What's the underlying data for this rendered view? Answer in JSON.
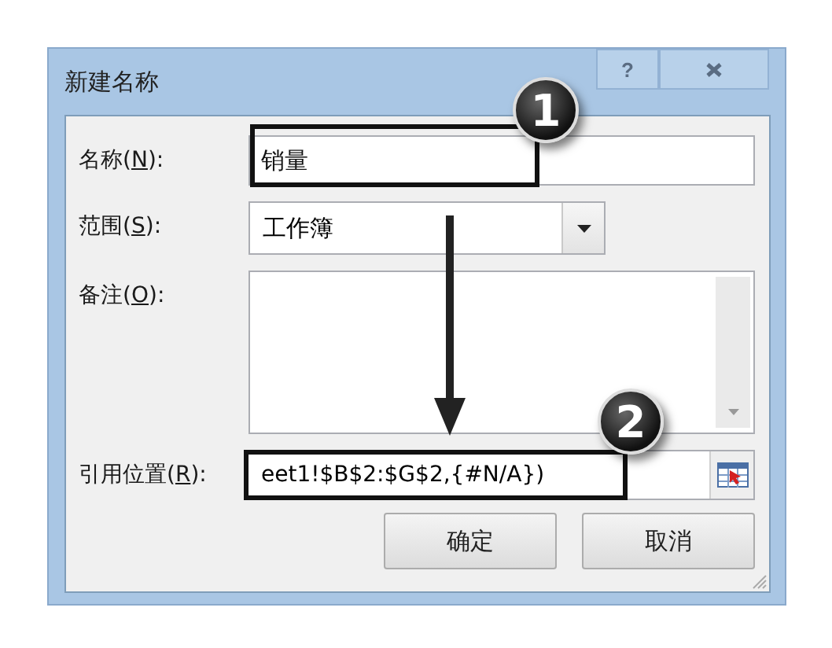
{
  "window": {
    "title": "新建名称",
    "help_button": "?"
  },
  "fields": [
    {
      "kind": "text",
      "label": {
        "before": "名称(",
        "key": "N",
        "after": "):"
      },
      "value": "销量"
    },
    {
      "kind": "dropdown",
      "label": {
        "before": "范围(",
        "key": "S",
        "after": "):"
      },
      "value": "工作簿"
    },
    {
      "kind": "memo",
      "label": {
        "before": "备注(",
        "key": "O",
        "after": "):"
      }
    },
    {
      "kind": "reference",
      "label": {
        "before": "引用位置(",
        "key": "R",
        "after": "):"
      },
      "value": "eet1!$B$2:$G$2,{#N/A})"
    }
  ],
  "buttons": [
    "确定",
    "取消"
  ],
  "annotations": [
    {
      "number": "1"
    },
    {
      "number": "2"
    }
  ]
}
